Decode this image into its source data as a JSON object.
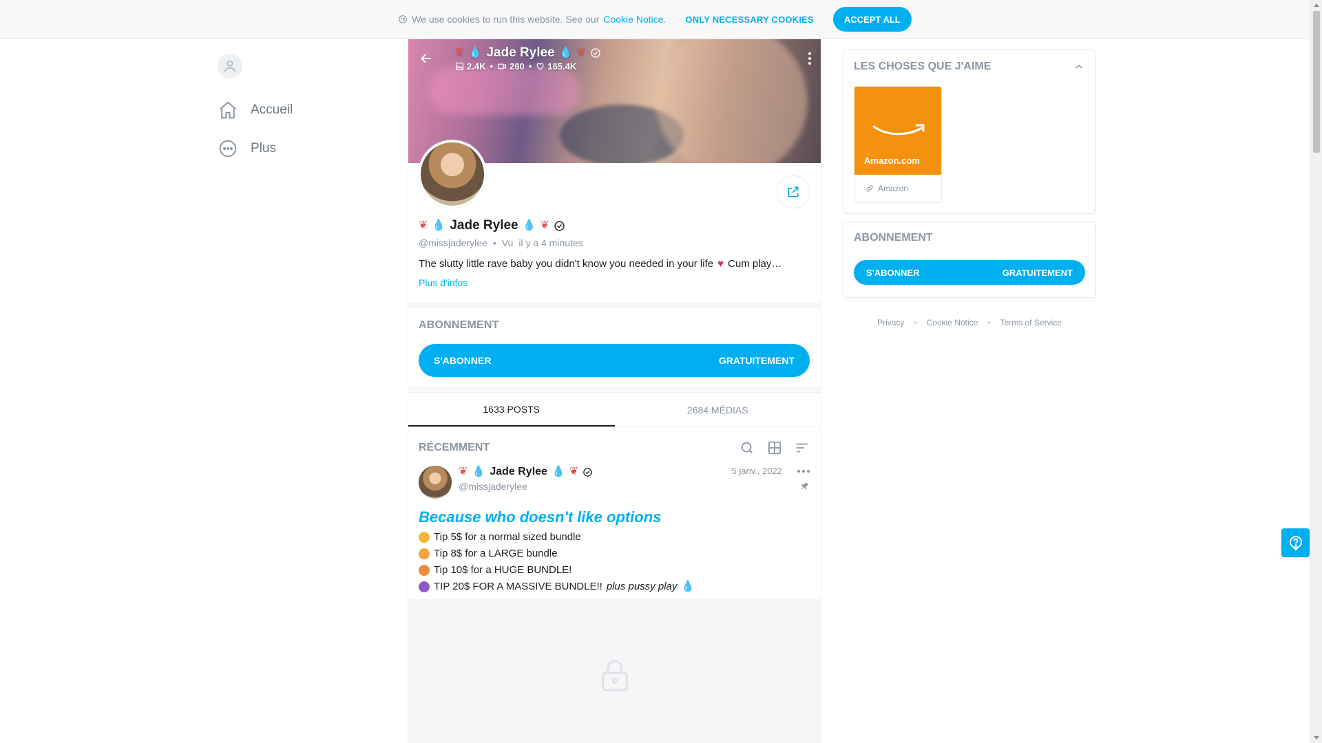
{
  "cookie_bar": {
    "text": "We use cookies to run this website. See our",
    "link": "Cookie Notice",
    "suffix": ".",
    "necessary_btn": "ONLY NECESSARY COOKIES",
    "accept_btn": "ACCEPT ALL"
  },
  "nav": {
    "items": [
      {
        "label": "Accueil",
        "icon": "home-icon"
      },
      {
        "label": "Plus",
        "icon": "more-circle-icon"
      }
    ]
  },
  "profile": {
    "name": "Jade Rylee",
    "stats": {
      "images": "2.4K",
      "videos": "260",
      "likes": "165.4K"
    },
    "handle": "@missjaderylee",
    "last_seen_prefix": "Vu",
    "last_seen": "il y a 4 minutes",
    "bio": "The slutty little rave baby you didn't know you needed in your life",
    "bio_suffix": "Cum play…",
    "more_info": "Plus d'infos"
  },
  "subscription": {
    "title": "ABONNEMENT",
    "button_left": "S'ABONNER",
    "button_right": "GRATUITEMENT"
  },
  "tabs": [
    {
      "label": "1633 POSTS",
      "active": true
    },
    {
      "label": "2684 MÉDIAS",
      "active": false
    }
  ],
  "recent": {
    "title": "RÉCEMMENT"
  },
  "post": {
    "author": "Jade Rylee",
    "handle": "@missjaderylee",
    "date": "5 janv., 2022",
    "heading": "Because who doesn't like options",
    "lines": [
      {
        "text": "Tip 5$ for a normal sized bundle",
        "face_color": "#f7b733"
      },
      {
        "text": "Tip 8$ for a LARGE bundle",
        "face_color": "#f6a33a"
      },
      {
        "text": "Tip 10$ for a HUGE BUNDLE!",
        "face_color": "#f08a3c"
      },
      {
        "text": "TIP 20$ FOR A MASSIVE BUNDLE!!",
        "face_color": "#8c5cc4",
        "italic_suffix": "plus pussy play"
      }
    ]
  },
  "sidebar": {
    "likes_title": "LES CHOSES QUE J'AIME",
    "amazon_name": "Amazon.com",
    "amazon_link": "Amazon",
    "sub_title": "ABONNEMENT",
    "sub_left": "S'ABONNER",
    "sub_right": "GRATUITEMENT"
  },
  "footer": {
    "links": [
      "Privacy",
      "Cookie Notice",
      "Terms of Service"
    ]
  },
  "colors": {
    "accent": "#00aff0",
    "muted": "#8a96a3",
    "amazon": "#f4920f"
  }
}
